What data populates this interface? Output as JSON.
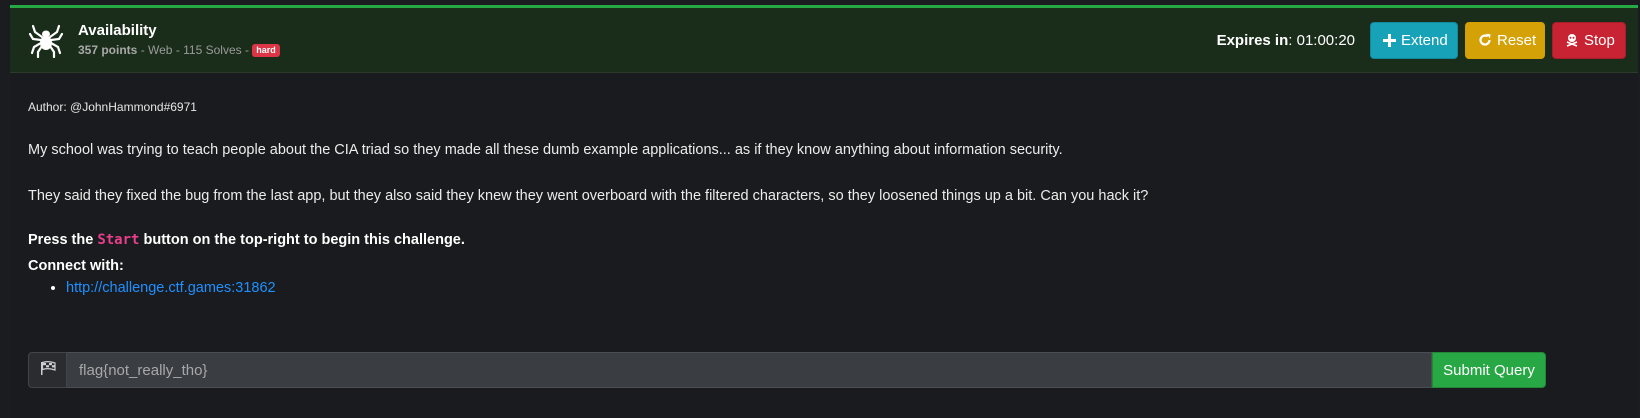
{
  "challenge": {
    "title": "Availability",
    "points": "357 points",
    "category_text": " - Web - 115 Solves - ",
    "difficulty": "hard",
    "icon": "spider-icon"
  },
  "timer": {
    "label": "Expires in",
    "separator": ": ",
    "value": "01:00:20"
  },
  "buttons": {
    "extend": "Extend",
    "reset": "Reset",
    "stop": "Stop"
  },
  "body": {
    "author": "Author: @JohnHammond#6971",
    "paragraph1": "My school was trying to teach people about the CIA triad so they made all these dumb example applications... as if they know anything about information security.",
    "paragraph2": "They said they fixed the bug from the last app, but they also said they knew they went overboard with the filtered characters, so they loosened things up a bit. Can you hack it?",
    "press_before": "Press the ",
    "press_code": "Start",
    "press_after": " button on the top-right to begin this challenge.",
    "connect_label": "Connect with:",
    "connect_link": "http://challenge.ctf.games:31862"
  },
  "flag_form": {
    "placeholder": "flag{not_really_tho}",
    "submit": "Submit Query"
  },
  "colors": {
    "header_bg": "#1a2d1b",
    "accent_green": "#28a745",
    "extend": "#17a2b8",
    "reset": "#d4a106",
    "stop": "#c82333",
    "badge": "#dc3545",
    "link": "#1e90ff",
    "code": "#e83e8c"
  }
}
